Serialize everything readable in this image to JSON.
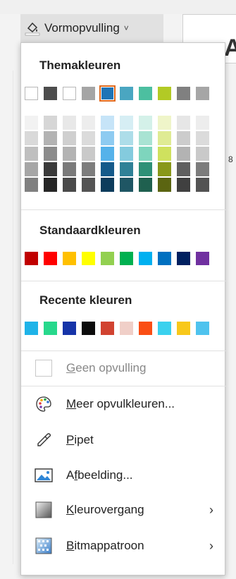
{
  "ribbon": {
    "button_label": "Vormopvulling",
    "chevron": "˅",
    "style_letter": "A",
    "side_number": "8"
  },
  "sections": {
    "theme": "Themakleuren",
    "standard": "Standaardkleuren",
    "recent": "Recente kleuren"
  },
  "theme_colors": [
    "#ffffff",
    "#4d4d4d",
    "#ffffff",
    "#a5a5a5",
    "#1f74b6",
    "#4aa6c1",
    "#4cbfa0",
    "#b2ca25",
    "#808080",
    "#a6a6a6"
  ],
  "selected_theme_index": 4,
  "shade_columns": [
    [
      "#f2f2f2",
      "#d9d9d9",
      "#bfbfbf",
      "#a6a6a6",
      "#808080"
    ],
    [
      "#d6d6d6",
      "#b3b3b3",
      "#8c8c8c",
      "#3a3a3a",
      "#262626"
    ],
    [
      "#e8e8e8",
      "#cfcfcf",
      "#b3b3b3",
      "#7a7a7a",
      "#4a4a4a"
    ],
    [
      "#ededed",
      "#dbdbdb",
      "#c9c9c9",
      "#7d7d7d",
      "#545454"
    ],
    [
      "#c6e4f8",
      "#8ecbf1",
      "#55b2ea",
      "#155a8a",
      "#0d3c5c"
    ],
    [
      "#d6eef4",
      "#addde9",
      "#84cbde",
      "#2f8197",
      "#1f5664"
    ],
    [
      "#d4f1e9",
      "#a9e3d3",
      "#7ed5bd",
      "#2e9077",
      "#1f604f"
    ],
    [
      "#eff5c9",
      "#dfeb94",
      "#cfe15e",
      "#89981a",
      "#5b6511"
    ],
    [
      "#e6e6e6",
      "#cccccc",
      "#b3b3b3",
      "#5f5f5f",
      "#404040"
    ],
    [
      "#ededed",
      "#dbdbdb",
      "#c9c9c9",
      "#7c7c7c",
      "#535353"
    ]
  ],
  "standard_colors": [
    "#c00000",
    "#ff0000",
    "#ffc000",
    "#ffff00",
    "#92d050",
    "#00b050",
    "#00b0f0",
    "#0070c0",
    "#002060",
    "#7030a0"
  ],
  "recent_colors": [
    "#1fb3e8",
    "#27d88c",
    "#1634a8",
    "#0c0c0c",
    "#d14331",
    "#f0cfc8",
    "#fa4e14",
    "#3bd1ee",
    "#f8c81b",
    "#4fc3ee"
  ],
  "menu": {
    "no_fill": "Geen opvulling",
    "more_colors": "Meer opvulkleuren...",
    "eyedropper": "Pipet",
    "picture": "Afbeelding...",
    "gradient": "Kleurovergang",
    "texture": "Bitmappatroon",
    "submenu_arrow": "›"
  }
}
